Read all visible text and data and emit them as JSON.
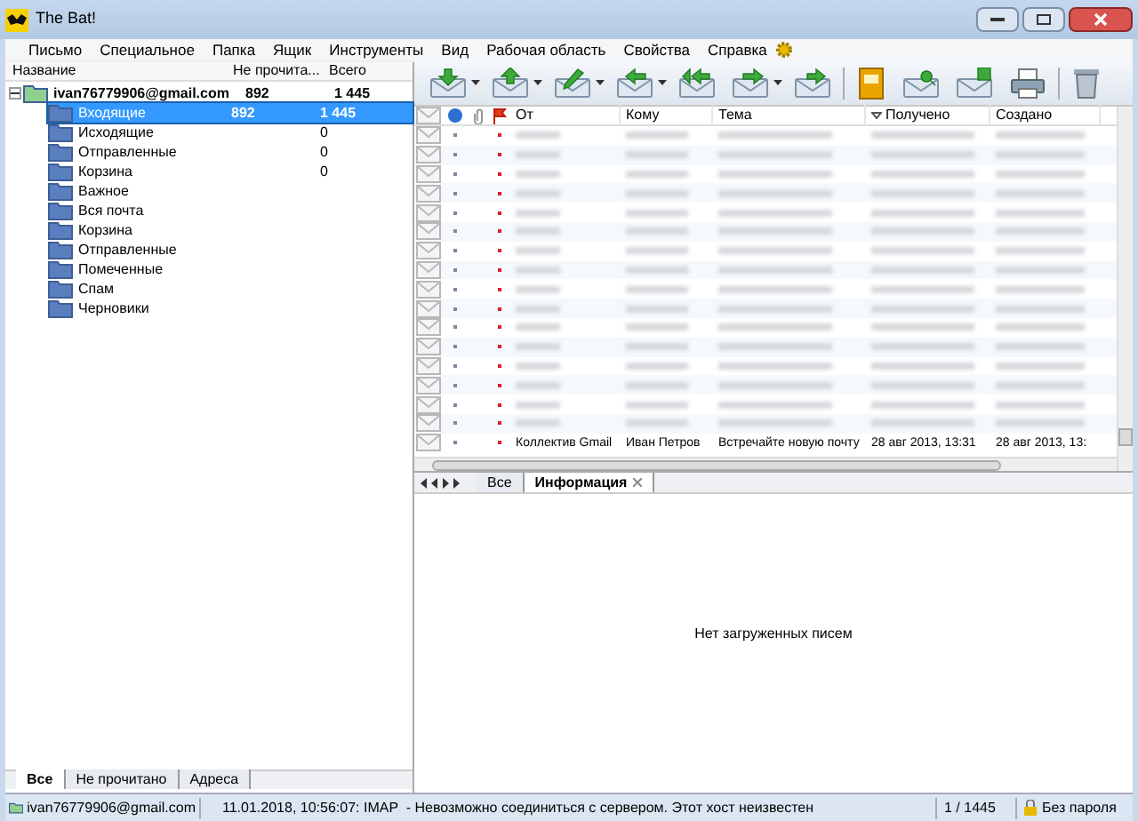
{
  "window": {
    "title": "The Bat!"
  },
  "menu": [
    "Письмо",
    "Специальное",
    "Папка",
    "Ящик",
    "Инструменты",
    "Вид",
    "Рабочая область",
    "Свойства",
    "Справка"
  ],
  "folder_tree": {
    "columns": [
      "Название",
      "Не прочита...",
      "Всего"
    ],
    "items": [
      {
        "name": "ivan76779906@gmail.com",
        "unread": "892",
        "total": "1 445",
        "selected": false,
        "expanded": true,
        "children": [
          {
            "name": "Входящие",
            "unread": "892",
            "total": "1 445",
            "selected": true
          },
          {
            "name": "Исходящие",
            "total": "0",
            "selected": false
          },
          {
            "name": "Отправленные",
            "total": "0",
            "selected": false
          },
          {
            "name": "Корзина",
            "total": "0",
            "selected": false
          },
          {
            "name": "Важное",
            "selected": false
          },
          {
            "name": "Вся почта",
            "selected": false
          },
          {
            "name": "Корзина",
            "selected": false
          },
          {
            "name": "Отправленные",
            "selected": false
          },
          {
            "name": "Помеченные",
            "selected": false
          },
          {
            "name": "Спам",
            "selected": false
          },
          {
            "name": "Черновики",
            "selected": false
          }
        ]
      }
    ]
  },
  "left_tabs": [
    {
      "label": "Все",
      "selected": true
    },
    {
      "label": "Не прочитано",
      "selected": false
    },
    {
      "label": "Адреса",
      "selected": false
    }
  ],
  "message_list": {
    "columns": [
      "От",
      "Кому",
      "Тема",
      "Получено",
      "Создано"
    ],
    "last_row": [
      "Коллектив Gmail",
      "Иван Петров",
      "Встречайте новую почту",
      "28 авг 2013, 13:31",
      "28 авг 2013, 13:"
    ]
  },
  "view_tabs": [
    {
      "label": "Все",
      "selected": false
    },
    {
      "label": "Информация",
      "selected": true
    }
  ],
  "preview": {
    "message": "Нет загруженных писем"
  },
  "status_bar": {
    "account": "ivan76779906@gmail.com",
    "log": "11.01.2018, 10:56:07: IMAP  - Невозможно соединиться с сервером. Этот хост неизвестен",
    "count": "1 / 1445",
    "password": "Без пароля"
  }
}
